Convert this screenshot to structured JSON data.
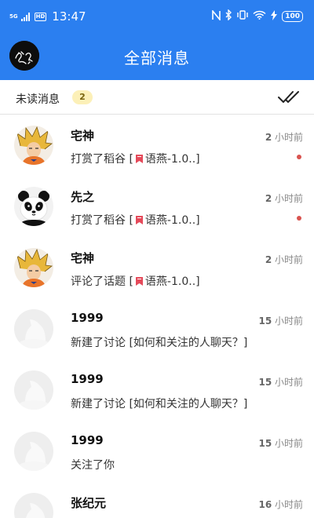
{
  "status_bar": {
    "network": "5G",
    "hd": "HD",
    "time": "13:47",
    "battery": "100",
    "icons": [
      "nfc-icon",
      "bluetooth-icon",
      "vibrate-icon",
      "wifi-icon",
      "charging-icon"
    ]
  },
  "header": {
    "title": "全部消息"
  },
  "filter": {
    "label": "未读消息",
    "count": "2"
  },
  "messages": [
    {
      "name": "宅神",
      "time_num": "2",
      "time_unit": " 小时前",
      "msg_prefix": "打赏了稻谷 [",
      "msg_topic": "语燕-1.0..]",
      "unread": true,
      "avatar": "goku"
    },
    {
      "name": "先之",
      "time_num": "2",
      "time_unit": " 小时前",
      "msg_prefix": "打赏了稻谷 [",
      "msg_topic": "语燕-1.0..]",
      "unread": true,
      "avatar": "panda"
    },
    {
      "name": "宅神",
      "time_num": "2",
      "time_unit": " 小时前",
      "msg_prefix": "评论了话题 [",
      "msg_topic": "语燕-1.0..]",
      "unread": false,
      "avatar": "goku"
    },
    {
      "name": "1999",
      "time_num": "15",
      "time_unit": " 小时前",
      "msg_prefix": "新建了讨论 [如何和关注的人聊天？]",
      "msg_topic": "",
      "unread": false,
      "avatar": "default"
    },
    {
      "name": "1999",
      "time_num": "15",
      "time_unit": " 小时前",
      "msg_prefix": "新建了讨论 [如何和关注的人聊天？]",
      "msg_topic": "",
      "unread": false,
      "avatar": "default"
    },
    {
      "name": "1999",
      "time_num": "15",
      "time_unit": " 小时前",
      "msg_prefix": "关注了你",
      "msg_topic": "",
      "unread": false,
      "avatar": "default"
    },
    {
      "name": "张纪元",
      "time_num": "16",
      "time_unit": " 小时前",
      "msg_prefix": "",
      "msg_topic": "",
      "unread": false,
      "avatar": "default"
    }
  ],
  "colors": {
    "primary": "#2b7ff0",
    "unread_dot": "#d9534f",
    "badge_bg": "#fcf0b8"
  }
}
